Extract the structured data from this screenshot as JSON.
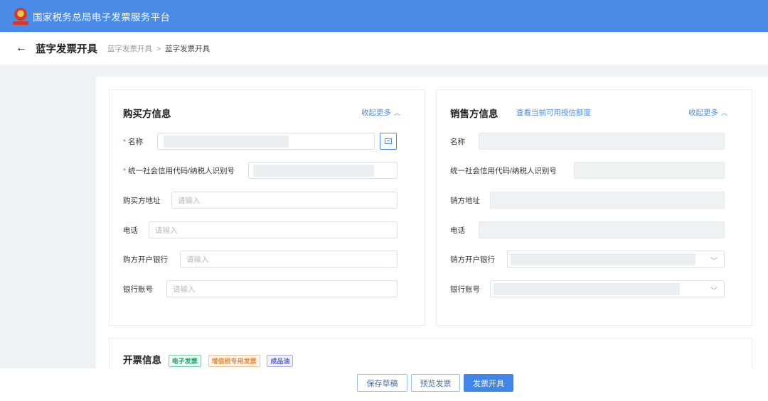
{
  "app": {
    "title": "国家税务总局电子发票服务平台"
  },
  "header": {
    "page_title": "蓝字发票开具",
    "breadcrumb": [
      "蓝字发票开具",
      "蓝字发票开具"
    ],
    "breadcrumb_sep": ">"
  },
  "buyer": {
    "title": "购买方信息",
    "collapse": "收起更多",
    "fields": {
      "name": {
        "label": "名称",
        "required": "*"
      },
      "tax_id": {
        "label": "统一社会信用代码/纳税人识别号",
        "required": "*"
      },
      "address": {
        "label": "购买方地址",
        "placeholder": "请输入"
      },
      "phone": {
        "label": "电话",
        "placeholder": "请输入"
      },
      "bank": {
        "label": "购方开户银行",
        "placeholder": "请输入"
      },
      "account": {
        "label": "银行账号",
        "placeholder": "请输入"
      }
    }
  },
  "seller": {
    "title": "销售方信息",
    "credit_link": "查看当前可用授信额度",
    "collapse": "收起更多",
    "fields": {
      "name": {
        "label": "名称"
      },
      "tax_id": {
        "label": "统一社会信用代码/纳税人识别号"
      },
      "address": {
        "label": "销方地址"
      },
      "phone": {
        "label": "电话"
      },
      "bank": {
        "label": "销方开户银行"
      },
      "account": {
        "label": "银行账号"
      }
    }
  },
  "invoice": {
    "title": "开票信息",
    "tags": [
      "电子发票",
      "增值税专用发票",
      "成品油"
    ]
  },
  "footer": {
    "save_draft": "保存草稿",
    "preview": "预览发票",
    "issue": "发票开具"
  },
  "icons": {
    "back": "back-arrow-icon",
    "emblem": "tax-emblem-icon",
    "collapse": "chevron-up-icon",
    "select": "chevron-down-icon",
    "pick": "list-picker-icon"
  },
  "colors": {
    "primary": "#4a8be8",
    "required": "#e5484d",
    "page_bg": "#f0f1f3"
  }
}
